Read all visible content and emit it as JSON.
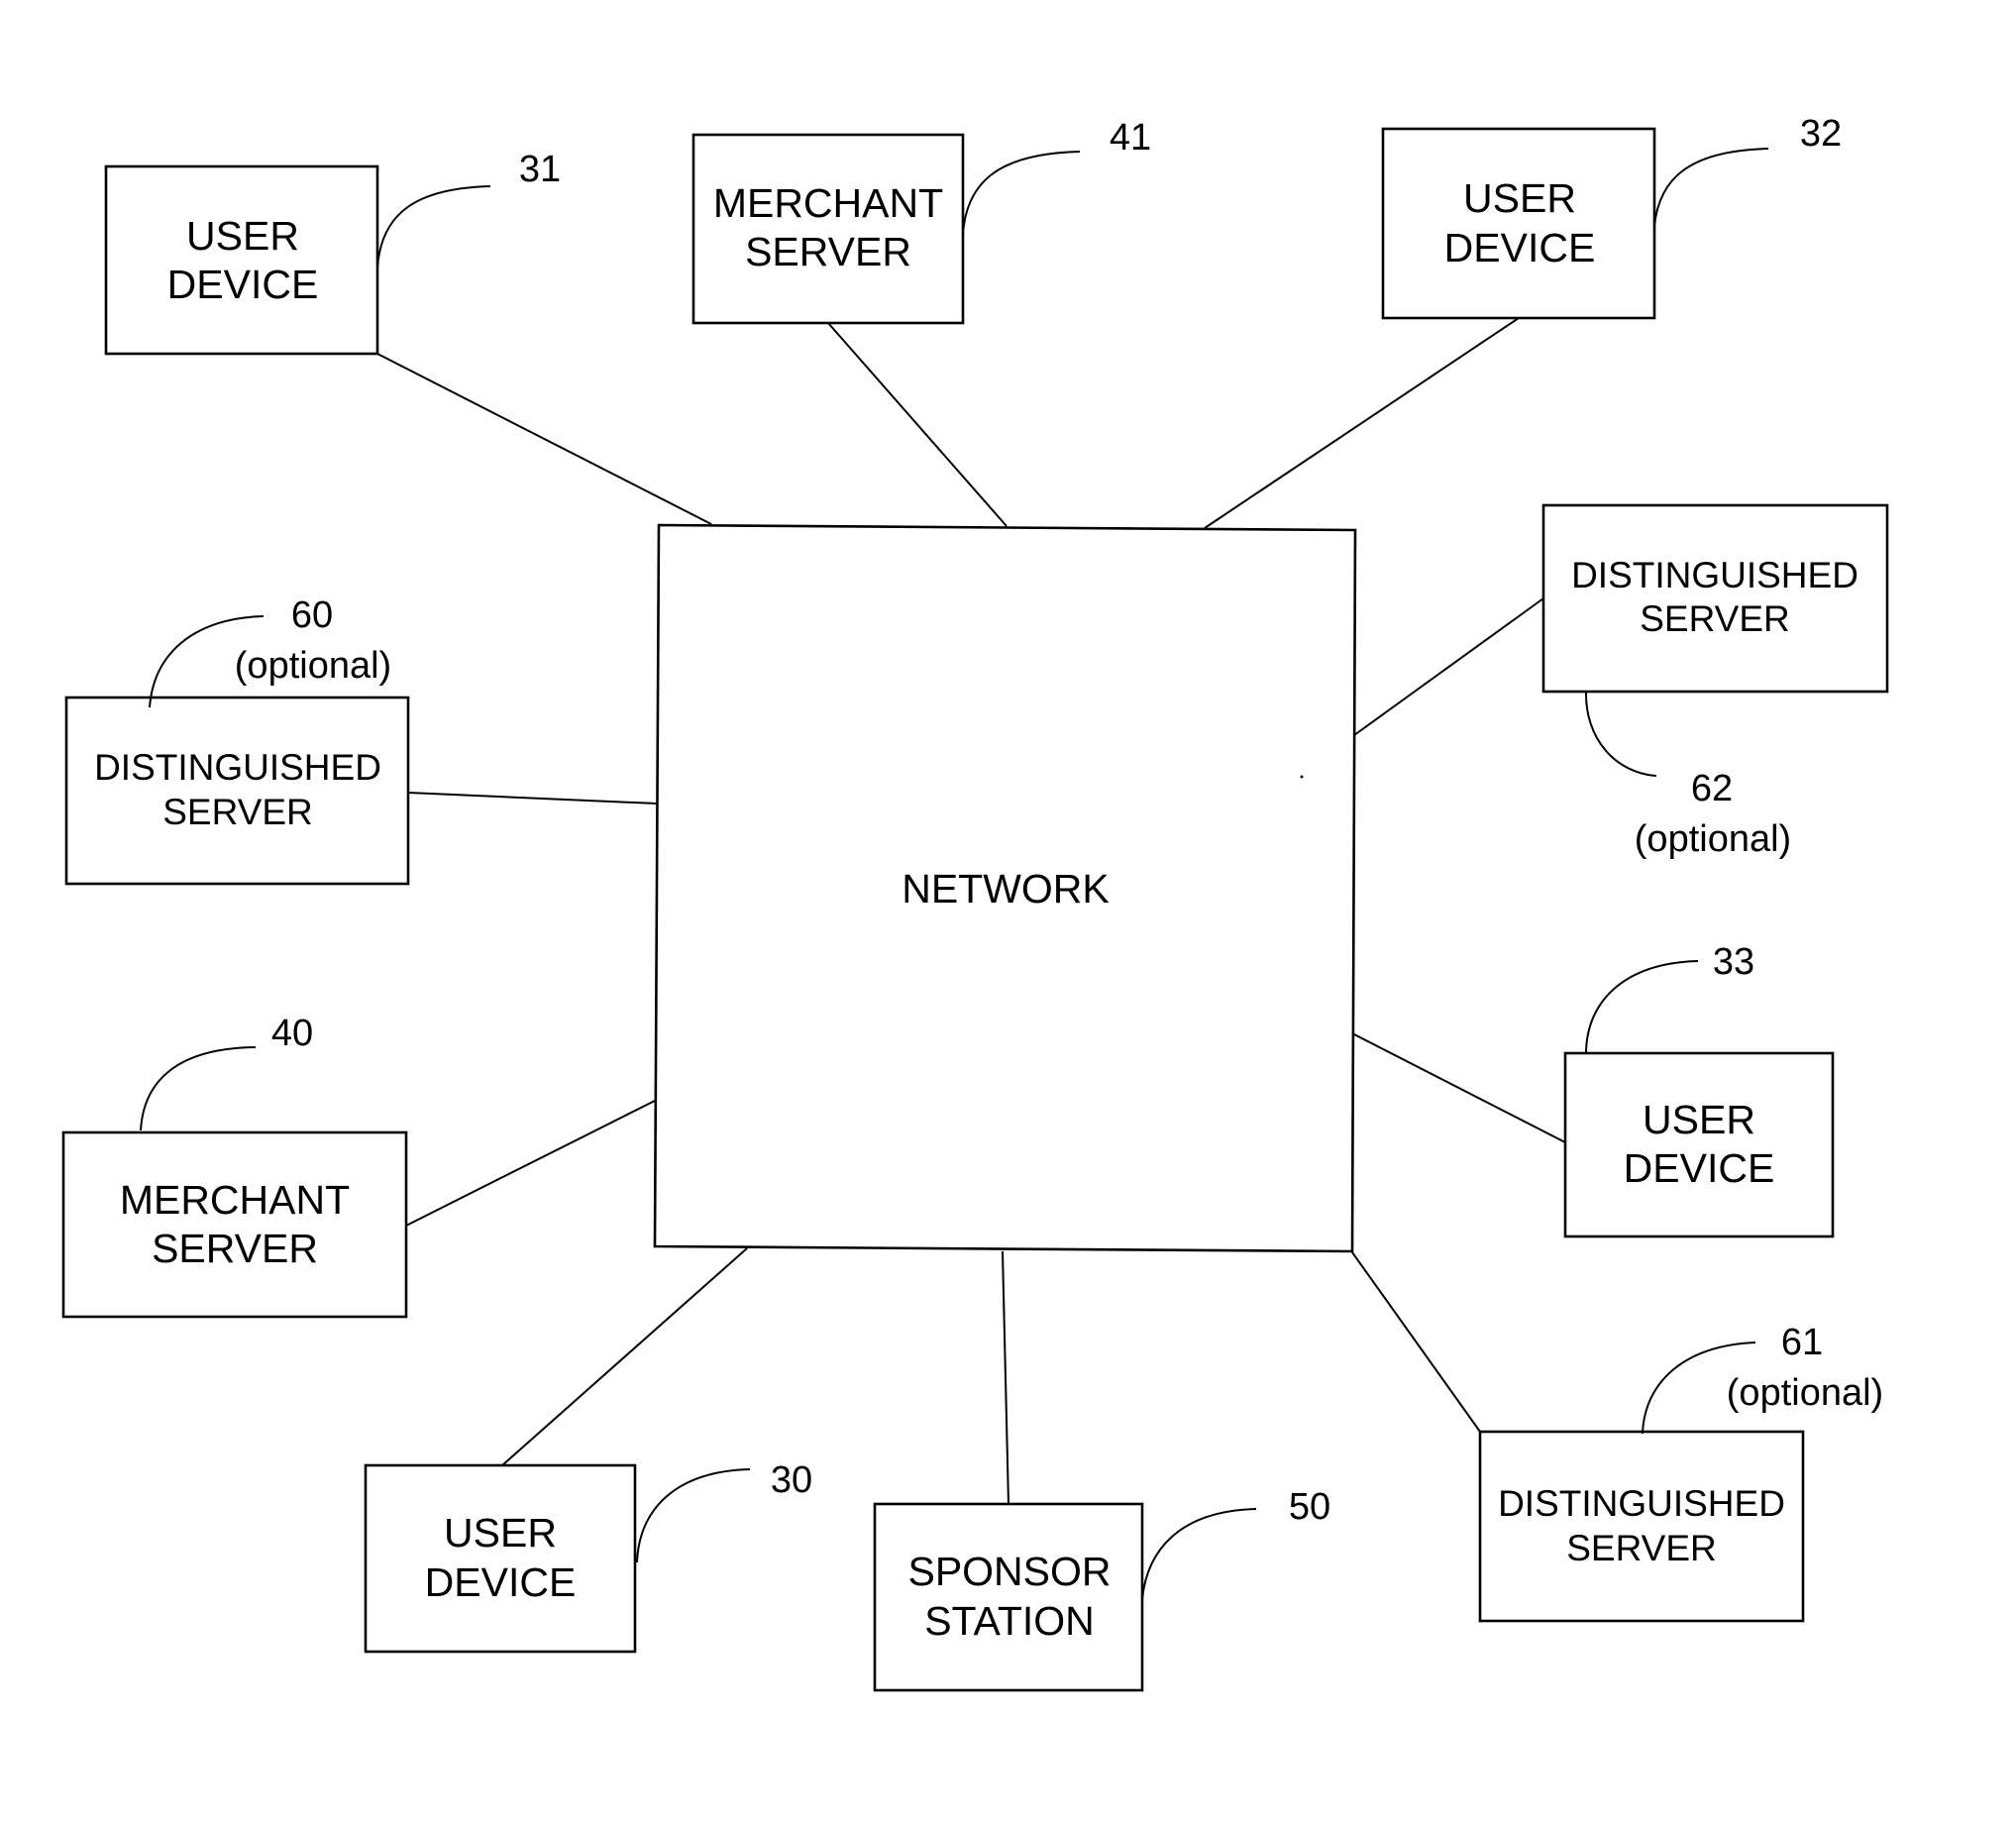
{
  "diagram": {
    "center": {
      "id": "network",
      "label": "NETWORK"
    },
    "nodes": [
      {
        "id": "user-device-31",
        "lines": [
          "USER",
          "DEVICE"
        ],
        "ref": "31",
        "note": ""
      },
      {
        "id": "merchant-server-41",
        "lines": [
          "MERCHANT",
          "SERVER"
        ],
        "ref": "41",
        "note": ""
      },
      {
        "id": "user-device-32",
        "lines": [
          "USER",
          "DEVICE"
        ],
        "ref": "32",
        "note": ""
      },
      {
        "id": "distinguished-server-62",
        "lines": [
          "DISTINGUISHED",
          "SERVER"
        ],
        "ref": "62",
        "note": "(optional)"
      },
      {
        "id": "distinguished-server-60",
        "lines": [
          "DISTINGUISHED",
          "SERVER"
        ],
        "ref": "60",
        "note": "(optional)"
      },
      {
        "id": "merchant-server-40",
        "lines": [
          "MERCHANT",
          "SERVER"
        ],
        "ref": "40",
        "note": ""
      },
      {
        "id": "user-device-33",
        "lines": [
          "USER",
          "DEVICE"
        ],
        "ref": "33",
        "note": ""
      },
      {
        "id": "user-device-30",
        "lines": [
          "USER",
          "DEVICE"
        ],
        "ref": "30",
        "note": ""
      },
      {
        "id": "sponsor-station-50",
        "lines": [
          "SPONSOR",
          "STATION"
        ],
        "ref": "50",
        "note": ""
      },
      {
        "id": "distinguished-server-61",
        "lines": [
          "DISTINGUISHED",
          "SERVER"
        ],
        "ref": "61",
        "note": "(optional)"
      }
    ],
    "connections": [
      [
        "user-device-31",
        "network"
      ],
      [
        "merchant-server-41",
        "network"
      ],
      [
        "user-device-32",
        "network"
      ],
      [
        "distinguished-server-62",
        "network"
      ],
      [
        "distinguished-server-60",
        "network"
      ],
      [
        "merchant-server-40",
        "network"
      ],
      [
        "user-device-33",
        "network"
      ],
      [
        "user-device-30",
        "network"
      ],
      [
        "sponsor-station-50",
        "network"
      ],
      [
        "distinguished-server-61",
        "network"
      ]
    ]
  }
}
